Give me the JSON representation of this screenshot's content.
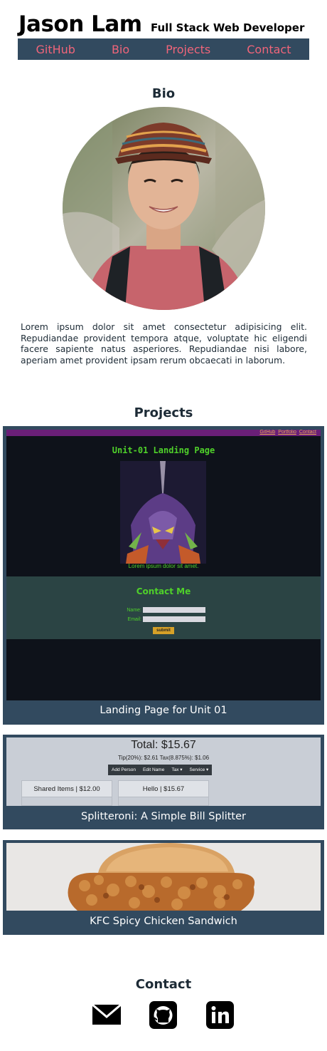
{
  "header": {
    "name": "Jason Lam",
    "role": "Full Stack Web Developer"
  },
  "nav": {
    "items": [
      "GitHub",
      "Bio",
      "Projects",
      "Contact"
    ],
    "link_color": "#f0657a",
    "bar_color": "#324a5f"
  },
  "bio": {
    "title": "Bio",
    "text": "Lorem ipsum dolor sit amet consectetur adipisicing elit. Repudiandae provident tempora atque, voluptate hic eligendi facere sapiente natus asperiores. Repudiandae nisi labore, aperiam amet provident ipsam rerum obcaecati in laborum."
  },
  "projects": {
    "title": "Projects",
    "items": [
      {
        "caption": "Landing Page for Unit 01",
        "preview": {
          "top_links": [
            "GitHub",
            "Portfolio",
            "Contact"
          ],
          "heading": "Unit-01 Landing Page",
          "image_text": "Lorem ipsum dolor sit amet.",
          "contact_title": "Contact Me",
          "name_label": "Name:",
          "email_label": "Email:",
          "submit_label": "submit"
        }
      },
      {
        "caption": "Splitteroni: A Simple Bill Splitter",
        "preview": {
          "total": "Total: $15.67",
          "tip_tax": "Tip(20%): $2.61 Tax(8.875%): $1.06",
          "buttons": [
            "Add Person",
            "Edit Name",
            "Tax ▾",
            "Service ▾"
          ],
          "columns": [
            "Shared Items | $12.00",
            "Hello | $15.67"
          ]
        }
      },
      {
        "caption": "KFC Spicy Chicken Sandwich"
      }
    ]
  },
  "contact": {
    "title": "Contact",
    "icons": [
      "email-icon",
      "github-icon",
      "linkedin-icon"
    ]
  }
}
